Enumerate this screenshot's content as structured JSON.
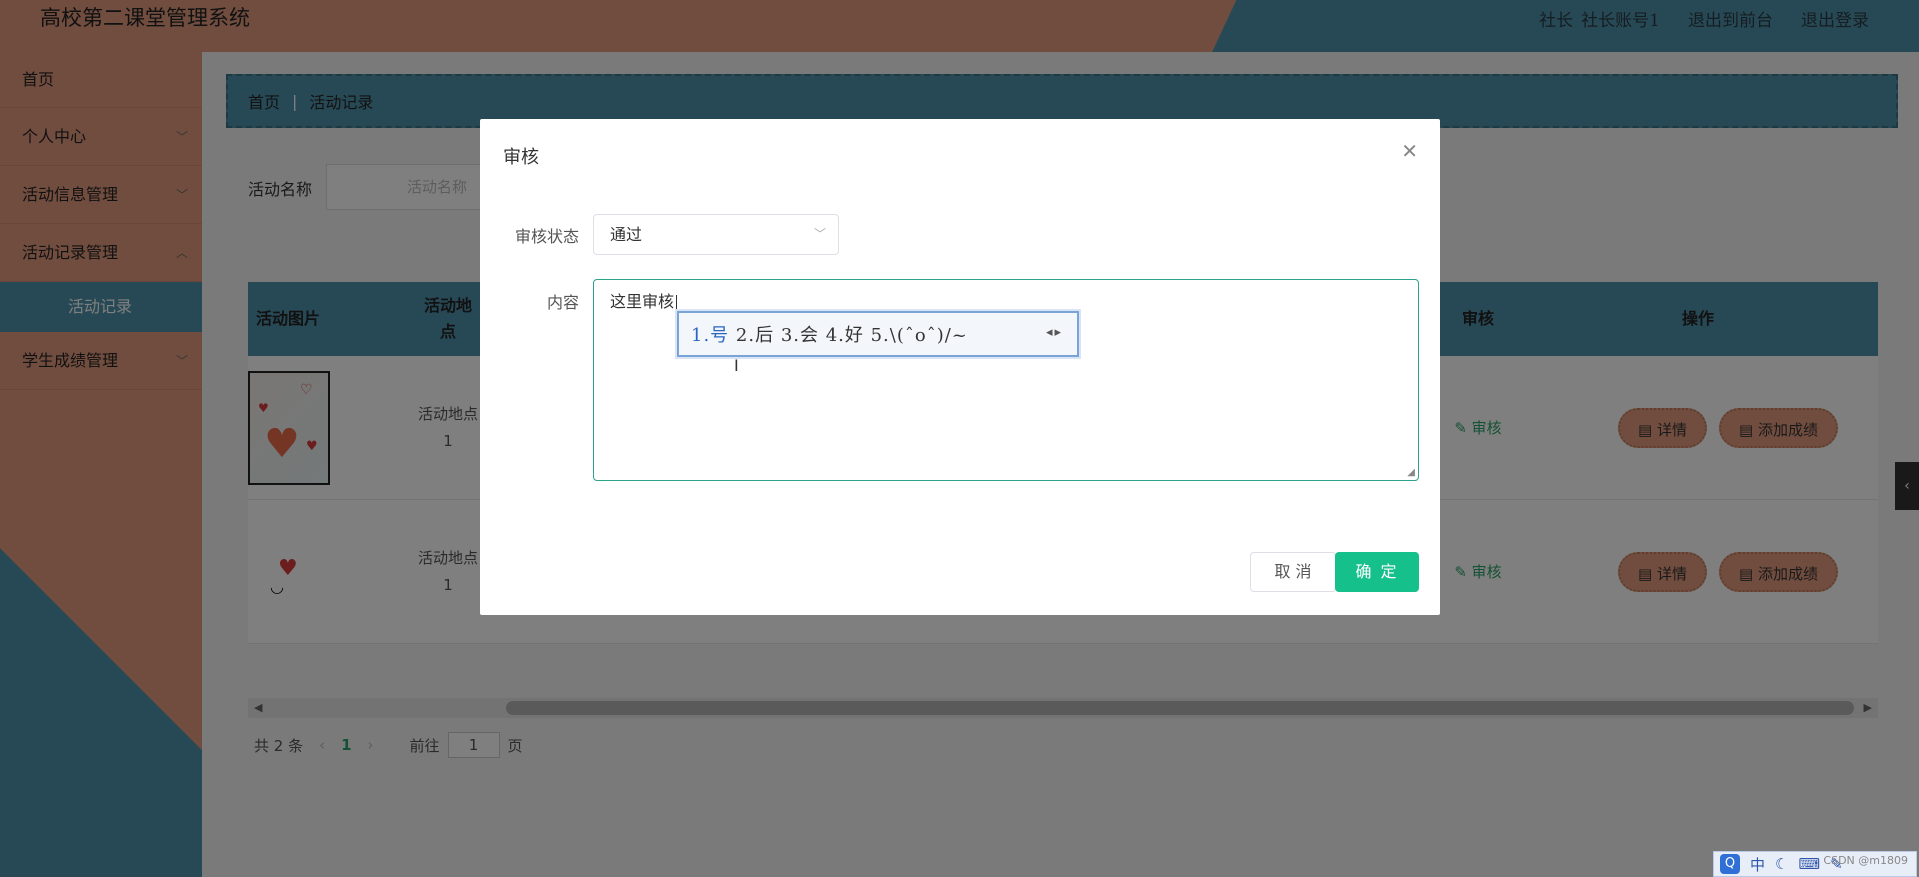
{
  "header": {
    "title": "高校第二课堂管理系统",
    "role": "社长",
    "account": "社长账号1",
    "to_front": "退出到前台",
    "logout": "退出登录"
  },
  "sidebar": {
    "items": [
      {
        "label": "首页"
      },
      {
        "label": "个人中心"
      },
      {
        "label": "活动信息管理"
      },
      {
        "label": "活动记录管理"
      },
      {
        "label": "活动记录"
      },
      {
        "label": "学生成绩管理"
      }
    ]
  },
  "breadcrumb": {
    "home": "首页",
    "current": "活动记录"
  },
  "search": {
    "label": "活动名称",
    "placeholder": "活动名称"
  },
  "table": {
    "headers": {
      "image": "活动图片",
      "location": "活动地点",
      "audit": "审核",
      "actions": "操作"
    },
    "rows": [
      {
        "location": "活动地点",
        "location_no": "1",
        "audit": "审核",
        "detail": "详情",
        "add_score": "添加成绩"
      },
      {
        "location": "活动地点",
        "location_no": "1",
        "audit": "审核",
        "detail": "详情",
        "add_score": "添加成绩"
      }
    ]
  },
  "pagination": {
    "total": "共 2 条",
    "current": "1",
    "goto": "前往",
    "page_value": "1",
    "page_unit": "页"
  },
  "dialog": {
    "title": "审核",
    "status_label": "审核状态",
    "status_value": "通过",
    "content_label": "内容",
    "content_value": "这里审核",
    "cancel": "取 消",
    "confirm": "确 定"
  },
  "ime": {
    "first": "1.号",
    "rest": "2.后 3.会 4.好 5.\\(ˆoˆ)/~"
  },
  "tray": {
    "q": "Q",
    "lang": "中",
    "watermark": "CSDN @m1809"
  },
  "colors": {
    "header_left": "#e39a7e",
    "header_right": "#4f93ab",
    "primary": "#16c08a",
    "pill": "#e39a7e"
  }
}
